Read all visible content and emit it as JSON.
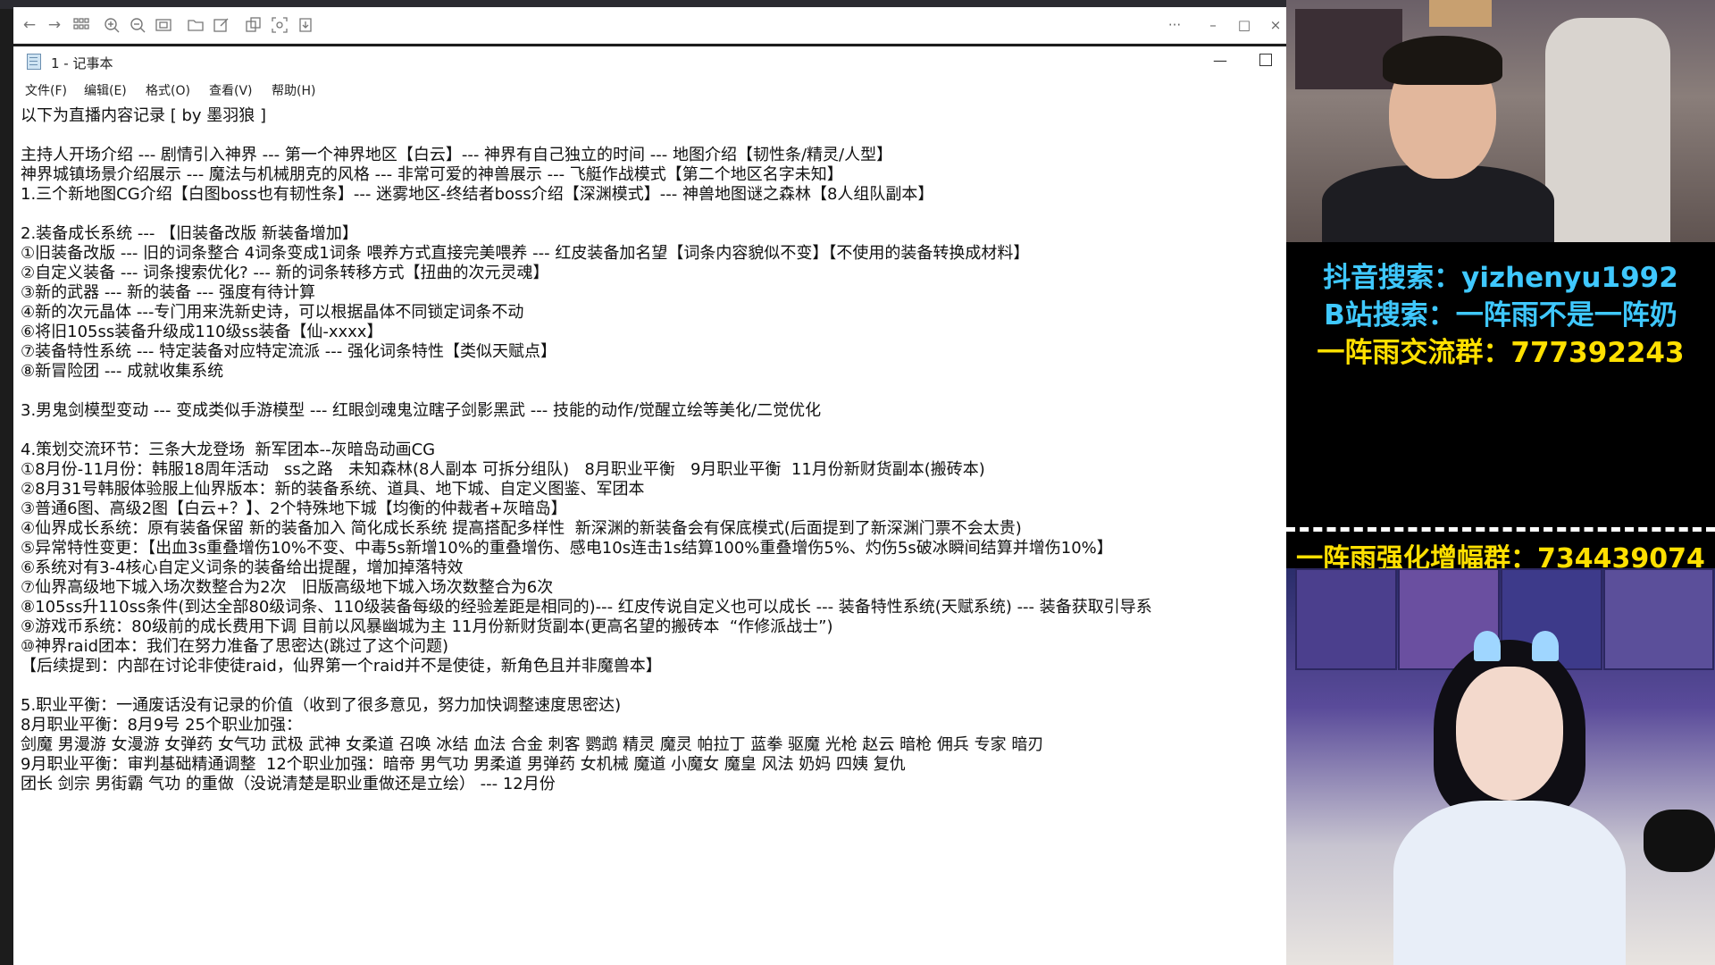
{
  "viewer": {
    "icons": [
      "back-arrow-icon",
      "forward-arrow-icon",
      "grid-icon",
      "zoom-in-icon",
      "zoom-out-icon",
      "fit-screen-icon",
      "folder-icon",
      "edit-icon",
      "copy-icon",
      "screenshot-icon",
      "download-icon"
    ],
    "more_label": "···",
    "minimize_label": "–",
    "maximize_label": "□",
    "close_label": "×"
  },
  "notepad": {
    "title": "1 - 记事本",
    "minimize_label": "—",
    "menu": [
      "文件(F)",
      "编辑(E)",
      "格式(O)",
      "查看(V)",
      "帮助(H)"
    ],
    "lines": [
      "以下为直播内容记录 [ by 墨羽狼 ]",
      "",
      "主持人开场介绍 --- 剧情引入神界 --- 第一个神界地区【白云】--- 神界有自己独立的时间 --- 地图介绍【韧性条/精灵/人型】",
      "神界城镇场景介绍展示 --- 魔法与机械朋克的风格 --- 非常可爱的神兽展示 --- 飞艇作战模式【第二个地区名字未知】",
      "1.三个新地图CG介绍【白图boss也有韧性条】--- 迷雾地区-终结者boss介绍【深渊模式】--- 神兽地图谜之森林【8人组队副本】",
      "",
      "2.装备成长系统 --- 【旧装备改版 新装备增加】",
      "①旧装备改版 --- 旧的词条整合 4词条变成1词条 喂养方式直接完美喂养 --- 红皮装备加名望【词条内容貌似不变】【不使用的装备转换成材料】",
      "②自定义装备 --- 词条搜索优化? --- 新的词条转移方式【扭曲的次元灵魂】",
      "③新的武器 --- 新的装备 --- 强度有待计算",
      "④新的次元晶体 ---专门用来洗新史诗，可以根据晶体不同锁定词条不动",
      "⑥将旧105ss装备升级成110级ss装备【仙-xxxx】",
      "⑦装备特性系统 --- 特定装备对应特定流派 --- 强化词条特性【类似天赋点】",
      "⑧新冒险团 --- 成就收集系统",
      "",
      "3.男鬼剑模型变动 --- 变成类似手游模型 --- 红眼剑魂鬼泣瞎子剑影黑武 --- 技能的动作/觉醒立绘等美化/二觉优化",
      "",
      "4.策划交流环节：三条大龙登场  新军团本--灰暗岛动画CG",
      "①8月份-11月份：韩服18周年活动   ss之路   未知森林(8人副本 可拆分组队)   8月职业平衡   9月职业平衡  11月份新财货副本(搬砖本)",
      "②8月31号韩服体验服上仙界版本：新的装备系统、道具、地下城、自定义图鉴、军团本",
      "③普通6图、高级2图【白云+？】、2个特殊地下城【均衡的仲裁者+灰暗岛】",
      "④仙界成长系统：原有装备保留 新的装备加入 简化成长系统 提高搭配多样性  新深渊的新装备会有保底模式(后面提到了新深渊门票不会太贵)",
      "⑤异常特性变更：【出血3s重叠增伤10%不变、中毒5s新增10%的重叠增伤、感电10s连击1s结算100%重叠增伤5%、灼伤5s破冰瞬间结算并增伤10%】",
      "⑥系统对有3-4核心自定义词条的装备给出提醒，增加掉落特效",
      "⑦仙界高级地下城入场次数整合为2次   旧版高级地下城入场次数整合为6次",
      "⑧105ss升110ss条件(到达全部80级词条、110级装备每级的经验差距是相同的)--- 红皮传说自定义也可以成长 --- 装备特性系统(天赋系统) --- 装备获取引导系",
      "⑨游戏币系统：80级前的成长费用下调 目前以风暴幽城为主 11月份新财货副本(更高名望的搬砖本  “作修派战士”)",
      "⑩神界raid团本：我们在努力准备了思密达(跳过了这个问题)",
      "【后续提到：内部在讨论非使徒raid，仙界第一个raid并不是使徒，新角色且并非魔兽本】",
      "",
      "5.职业平衡：一通废话没有记录的价值（收到了很多意见，努力加快调整速度思密达)",
      "8月职业平衡：8月9号 25个职业加强：",
      "剑魔 男漫游 女漫游 女弹药 女气功 武极 武神 女柔道 召唤 冰结 血法 合金 刺客 鹦鹉 精灵 魔灵 帕拉丁 蓝拳 驱魔 光枪 赵云 暗枪 佣兵 专家 暗刃",
      "9月职业平衡：审判基础精通调整  12个职业加强：暗帝 男气功 男柔道 男弹药 女机械 魔道 小魔女 魔皇 风法 奶妈 四姨 复仇",
      "团长 剑宗 男街霸 气功 的重做（没说清楚是职业重做还是立绘） --- 12月份"
    ]
  },
  "stream_overlay": {
    "promo_lines": [
      "抖音搜索：yizhenyu1992",
      "B站搜索：一阵雨不是一阵奶",
      "一阵雨交流群：777392243"
    ],
    "promo_bottom": "一阵雨强化增幅群：734439074"
  }
}
